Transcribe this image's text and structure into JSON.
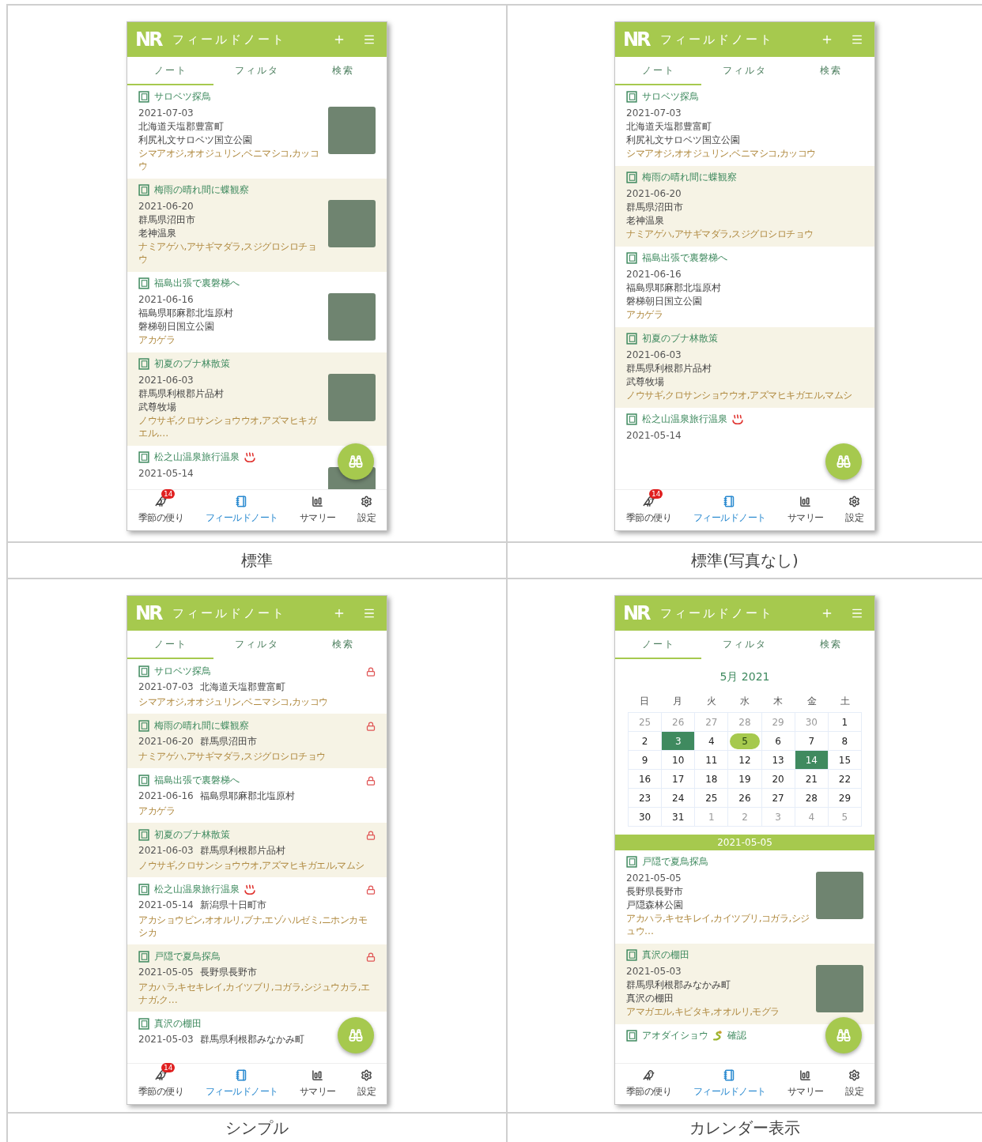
{
  "panels": [
    {
      "caption": "標準",
      "kind": "standard",
      "app_bar": {
        "logo": "NR",
        "title": "フィールドノート"
      },
      "tabs": [
        {
          "label": "ノート",
          "selected": true
        },
        {
          "label": "フィルタ",
          "selected": false
        },
        {
          "label": "検索",
          "selected": false
        }
      ],
      "notes": [
        {
          "title": "サロベツ探鳥",
          "date": "2021-07-03",
          "place": "北海道天塩郡豊富町",
          "site": "利尻礼文サロベツ国立公園",
          "species": "シマアオジ,オオジュリン,ベニマシコ,カッコウ",
          "photo": true
        },
        {
          "title": "梅雨の晴れ間に蝶観察",
          "date": "2021-06-20",
          "place": "群馬県沼田市",
          "site": "老神温泉",
          "species": "ナミアゲハ,アサギマダラ,スジグロシロチョウ",
          "photo": true
        },
        {
          "title": "福島出張で裏磐梯へ",
          "date": "2021-06-16",
          "place": "福島県耶麻郡北塩原村",
          "site": "磐梯朝日国立公園",
          "species": "アカゲラ",
          "photo": true
        },
        {
          "title": "初夏のブナ林散策",
          "date": "2021-06-03",
          "place": "群馬県利根郡片品村",
          "site": "武尊牧場",
          "species": "ノウサギ,クロサンショウウオ,アズマヒキガエル,…",
          "photo": true
        },
        {
          "title": "松之山温泉旅行温泉",
          "title_icon": {
            "kind": "hot-spring"
          },
          "date": "2021-05-14",
          "photo": true
        }
      ],
      "nav": [
        {
          "label": "季節の便り",
          "selected": false,
          "badge": "14"
        },
        {
          "label": "フィールドノート",
          "selected": true
        },
        {
          "label": "サマリー",
          "selected": false
        },
        {
          "label": "設定",
          "selected": false
        }
      ]
    },
    {
      "caption": "標準(写真なし)",
      "kind": "standard",
      "app_bar": {
        "logo": "NR",
        "title": "フィールドノート"
      },
      "tabs": [
        {
          "label": "ノート",
          "selected": true
        },
        {
          "label": "フィルタ",
          "selected": false
        },
        {
          "label": "検索",
          "selected": false
        }
      ],
      "notes": [
        {
          "title": "サロベツ探鳥",
          "date": "2021-07-03",
          "place": "北海道天塩郡豊富町",
          "site": "利尻礼文サロベツ国立公園",
          "species": "シマアオジ,オオジュリン,ベニマシコ,カッコウ",
          "photo": false
        },
        {
          "title": "梅雨の晴れ間に蝶観察",
          "date": "2021-06-20",
          "place": "群馬県沼田市",
          "site": "老神温泉",
          "species": "ナミアゲハ,アサギマダラ,スジグロシロチョウ",
          "photo": false
        },
        {
          "title": "福島出張で裏磐梯へ",
          "date": "2021-06-16",
          "place": "福島県耶麻郡北塩原村",
          "site": "磐梯朝日国立公園",
          "species": "アカゲラ",
          "photo": false
        },
        {
          "title": "初夏のブナ林散策",
          "date": "2021-06-03",
          "place": "群馬県利根郡片品村",
          "site": "武尊牧場",
          "species": "ノウサギ,クロサンショウウオ,アズマヒキガエル,マムシ",
          "photo": false
        },
        {
          "title": "松之山温泉旅行温泉",
          "title_icon": {
            "kind": "hot-spring"
          },
          "date": "2021-05-14",
          "photo": false
        }
      ],
      "nav": [
        {
          "label": "季節の便り",
          "selected": false,
          "badge": "14"
        },
        {
          "label": "フィールドノート",
          "selected": true
        },
        {
          "label": "サマリー",
          "selected": false
        },
        {
          "label": "設定",
          "selected": false
        }
      ]
    },
    {
      "caption": "シンプル",
      "kind": "simple",
      "app_bar": {
        "logo": "NR",
        "title": "フィールドノート"
      },
      "tabs": [
        {
          "label": "ノート",
          "selected": true
        },
        {
          "label": "フィルタ",
          "selected": false
        },
        {
          "label": "検索",
          "selected": false
        }
      ],
      "notes": [
        {
          "title": "サロベツ探鳥",
          "date": "2021-07-03",
          "place": "北海道天塩郡豊富町",
          "species": "シマアオジ,オオジュリン,ベニマシコ,カッコウ",
          "locked": true
        },
        {
          "title": "梅雨の晴れ間に蝶観察",
          "date": "2021-06-20",
          "place": "群馬県沼田市",
          "species": "ナミアゲハ,アサギマダラ,スジグロシロチョウ",
          "locked": true
        },
        {
          "title": "福島出張で裏磐梯へ",
          "date": "2021-06-16",
          "place": "福島県耶麻郡北塩原村",
          "species": "アカゲラ",
          "locked": true
        },
        {
          "title": "初夏のブナ林散策",
          "date": "2021-06-03",
          "place": "群馬県利根郡片品村",
          "species": "ノウサギ,クロサンショウウオ,アズマヒキガエル,マムシ",
          "locked": true
        },
        {
          "title": "松之山温泉旅行温泉",
          "title_icon": {
            "kind": "hot-spring"
          },
          "date": "2021-05-14",
          "place": "新潟県十日町市",
          "species": "アカショウビン,オオルリ,ブナ,エゾハルゼミ,ニホンカモシカ",
          "locked": true
        },
        {
          "title": "戸隠で夏鳥探鳥",
          "date": "2021-05-05",
          "place": "長野県長野市",
          "species": "アカハラ,キセキレイ,カイツブリ,コガラ,シジュウカラ,エナガ,ク…",
          "locked": true
        },
        {
          "title": "真沢の棚田",
          "date": "2021-05-03",
          "place": "群馬県利根郡みなかみ町",
          "locked": false
        }
      ],
      "nav": [
        {
          "label": "季節の便り",
          "selected": false,
          "badge": "14"
        },
        {
          "label": "フィールドノート",
          "selected": true
        },
        {
          "label": "サマリー",
          "selected": false
        },
        {
          "label": "設定",
          "selected": false
        }
      ]
    },
    {
      "caption": "カレンダー表示",
      "kind": "calendar",
      "app_bar": {
        "logo": "NR",
        "title": "フィールドノート"
      },
      "tabs": [
        {
          "label": "ノート",
          "selected": true
        },
        {
          "label": "フィルタ",
          "selected": false
        },
        {
          "label": "検索",
          "selected": false
        }
      ],
      "calendar": {
        "month": "5月 2021",
        "weekdays": [
          "日",
          "月",
          "火",
          "水",
          "木",
          "金",
          "土"
        ],
        "days": [
          {
            "day": "25",
            "kind": "outside"
          },
          {
            "day": "26",
            "kind": "outside"
          },
          {
            "day": "27",
            "kind": "outside"
          },
          {
            "day": "28",
            "kind": "outside"
          },
          {
            "day": "29",
            "kind": "outside"
          },
          {
            "day": "30",
            "kind": "outside"
          },
          {
            "day": "1",
            "kind": "normal"
          },
          {
            "day": "2",
            "kind": "normal"
          },
          {
            "day": "3",
            "kind": "noted"
          },
          {
            "day": "4",
            "kind": "normal"
          },
          {
            "day": "5",
            "kind": "selected"
          },
          {
            "day": "6",
            "kind": "normal"
          },
          {
            "day": "7",
            "kind": "normal"
          },
          {
            "day": "8",
            "kind": "normal"
          },
          {
            "day": "9",
            "kind": "normal"
          },
          {
            "day": "10",
            "kind": "normal"
          },
          {
            "day": "11",
            "kind": "normal"
          },
          {
            "day": "12",
            "kind": "normal"
          },
          {
            "day": "13",
            "kind": "normal"
          },
          {
            "day": "14",
            "kind": "noted"
          },
          {
            "day": "15",
            "kind": "normal"
          },
          {
            "day": "16",
            "kind": "normal"
          },
          {
            "day": "17",
            "kind": "normal"
          },
          {
            "day": "18",
            "kind": "normal"
          },
          {
            "day": "19",
            "kind": "normal"
          },
          {
            "day": "20",
            "kind": "normal"
          },
          {
            "day": "21",
            "kind": "normal"
          },
          {
            "day": "22",
            "kind": "normal"
          },
          {
            "day": "23",
            "kind": "normal"
          },
          {
            "day": "24",
            "kind": "normal"
          },
          {
            "day": "25",
            "kind": "normal"
          },
          {
            "day": "26",
            "kind": "normal"
          },
          {
            "day": "27",
            "kind": "normal"
          },
          {
            "day": "28",
            "kind": "normal"
          },
          {
            "day": "29",
            "kind": "normal"
          },
          {
            "day": "30",
            "kind": "normal"
          },
          {
            "day": "31",
            "kind": "normal"
          },
          {
            "day": "1",
            "kind": "outside"
          },
          {
            "day": "2",
            "kind": "outside"
          },
          {
            "day": "3",
            "kind": "outside"
          },
          {
            "day": "4",
            "kind": "outside"
          },
          {
            "day": "5",
            "kind": "outside"
          }
        ],
        "selected_date": "2021-05-05"
      },
      "notes": [
        {
          "title": "戸隠で夏鳥探鳥",
          "date": "2021-05-05",
          "place": "長野県長野市",
          "site": "戸隠森林公園",
          "species": "アカハラ,キセキレイ,カイツブリ,コガラ,シジュウ…",
          "photo": true
        },
        {
          "title": "真沢の棚田",
          "date": "2021-05-03",
          "place": "群馬県利根郡みなかみ町",
          "site": "真沢の棚田",
          "species": "アマガエル,キビタキ,オオルリ,モグラ",
          "photo": true
        },
        {
          "title": "アオダイショウ",
          "title_icon": {
            "kind": "snake"
          },
          "title_after": "確認"
        }
      ],
      "nav": [
        {
          "label": "季節の便り",
          "selected": false
        },
        {
          "label": "フィールドノート",
          "selected": true
        },
        {
          "label": "サマリー",
          "selected": false
        },
        {
          "label": "設定",
          "selected": false
        }
      ]
    }
  ]
}
